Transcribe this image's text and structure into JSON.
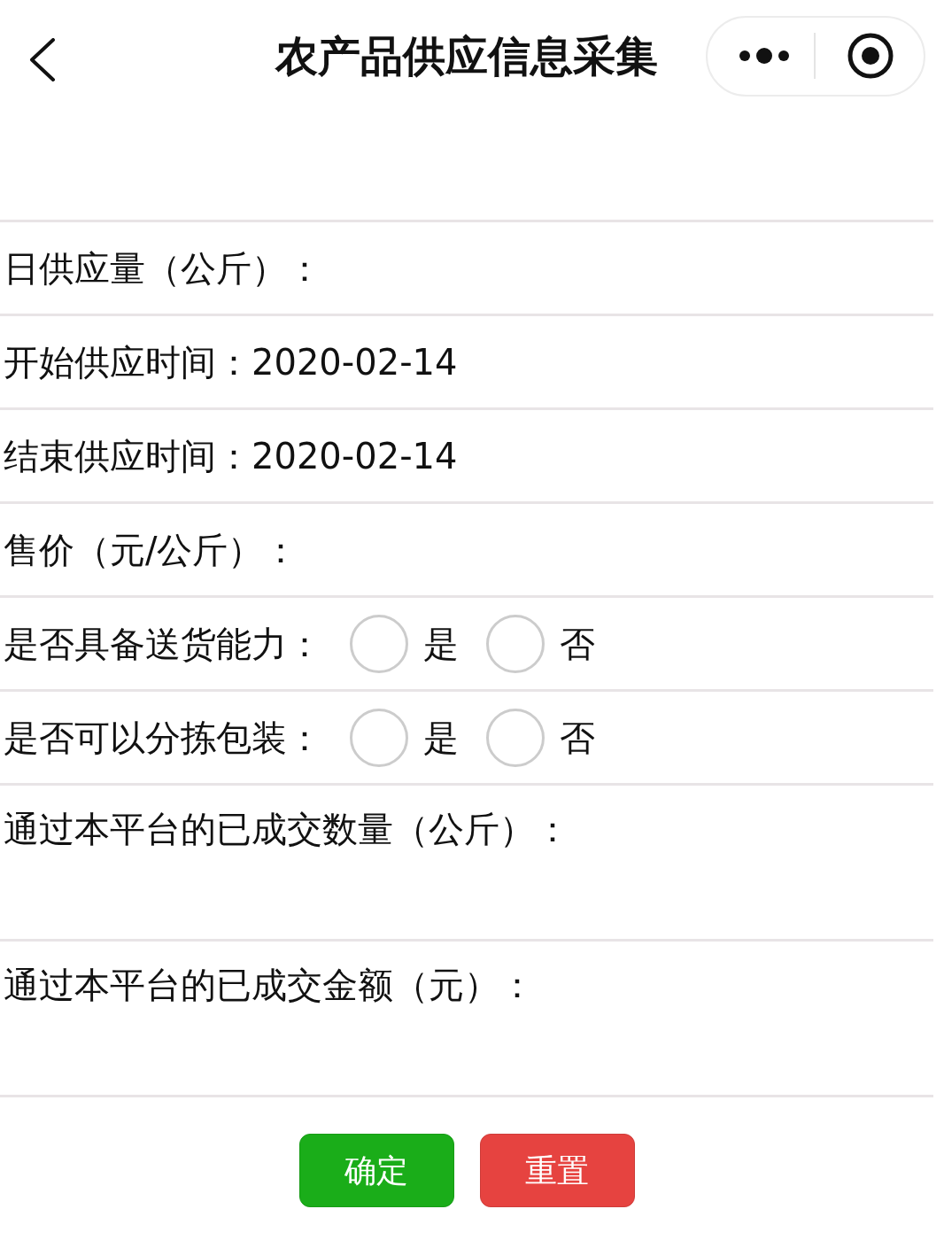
{
  "nav_bar": {
    "title": "农产品供应信息采集"
  },
  "fields": [
    {
      "kind": "text",
      "label": "日供应量（公斤）："
    },
    {
      "kind": "date",
      "label": "开始供应时间：",
      "value": "2020-02-14"
    },
    {
      "kind": "date",
      "label": "结束供应时间：",
      "value": "2020-02-14"
    },
    {
      "kind": "text",
      "label": "售价（元/公斤）："
    },
    {
      "kind": "radio",
      "label": "是否具备送货能力：",
      "options": [
        {
          "label": "是",
          "selected": false
        },
        {
          "label": "否",
          "selected": false
        }
      ]
    },
    {
      "kind": "radio",
      "label": "是否可以分拣包装：",
      "options": [
        {
          "label": "是",
          "selected": false
        },
        {
          "label": "否",
          "selected": false
        }
      ]
    },
    {
      "kind": "textarea",
      "label": "通过本平台的已成交数量（公斤）："
    },
    {
      "kind": "textarea",
      "label": "通过本平台的已成交金额（元）："
    }
  ],
  "buttons": [
    {
      "kind": "primary",
      "label": "确定"
    },
    {
      "kind": "danger",
      "label": "重置"
    }
  ]
}
